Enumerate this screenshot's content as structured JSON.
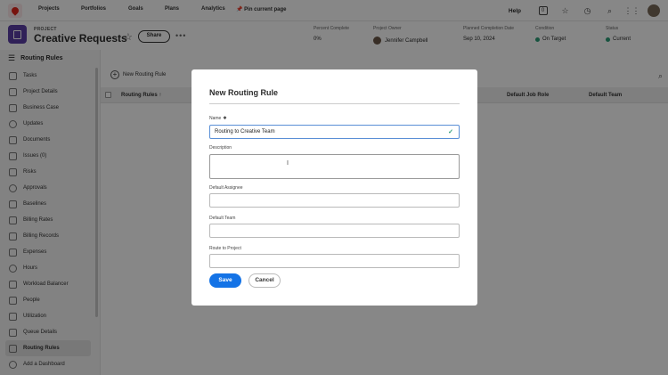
{
  "topnav": {
    "items": [
      "Projects",
      "Portfolios",
      "Goals",
      "Plans",
      "Analytics"
    ],
    "pin": "Pin current page",
    "help": "Help",
    "badge": "0"
  },
  "project": {
    "label": "PROJECT",
    "title": "Creative Requests",
    "share": "Share",
    "more": "•••",
    "meta": [
      {
        "label": "Percent Complete",
        "value": "0%"
      },
      {
        "label": "Project Owner",
        "value": "Jennifer Campbell"
      },
      {
        "label": "Planned Completion Date",
        "value": "Sep 10, 2024"
      },
      {
        "label": "Condition",
        "value": "On Target"
      },
      {
        "label": "Status",
        "value": "Current"
      }
    ]
  },
  "sidebar": {
    "header": "Routing Rules",
    "items": [
      "Tasks",
      "Project Details",
      "Business Case",
      "Updates",
      "Documents",
      "Issues (0)",
      "Risks",
      "Approvals",
      "Baselines",
      "Billing Rates",
      "Billing Records",
      "Expenses",
      "Hours",
      "Workload Balancer",
      "People",
      "Utilization",
      "Queue Details",
      "Routing Rules",
      "Add a Dashboard"
    ]
  },
  "main": {
    "new_rule": "New Routing Rule",
    "columns": [
      "Routing Rules ↑",
      "Default Job Role",
      "Default Team"
    ]
  },
  "modal": {
    "title": "New Routing Rule",
    "name_label": "Name",
    "name_required": "✱",
    "name_value": "Routing to Creative Team",
    "description_label": "Description",
    "assignee_label": "Default Assignee",
    "team_label": "Default Team",
    "route_label": "Route to Project",
    "save": "Save",
    "cancel": "Cancel"
  },
  "colors": {
    "accent": "#1473e6",
    "project_icon": "#5b3fa6",
    "on_target": "#2d9d78",
    "brand": "#e1251b"
  }
}
